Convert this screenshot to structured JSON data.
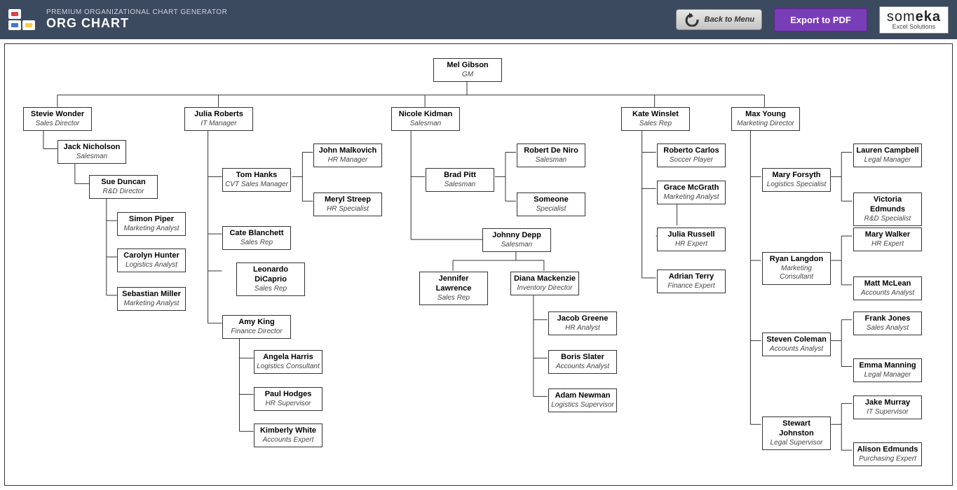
{
  "header": {
    "subtitle": "PREMIUM ORGANIZATIONAL CHART GENERATOR",
    "title": "ORG CHART",
    "back_label": "Back to Menu",
    "export_label": "Export to PDF",
    "brand_name_light": "som",
    "brand_name_bold": "eka",
    "brand_tag": "Excel Solutions"
  },
  "nodes": {
    "root": {
      "name": "Mel Gibson",
      "role": "GM"
    },
    "stevie": {
      "name": "Stevie Wonder",
      "role": "Sales Director"
    },
    "julia": {
      "name": "Julia Roberts",
      "role": "IT Manager"
    },
    "nicole": {
      "name": "Nicole Kidman",
      "role": "Salesman"
    },
    "kate": {
      "name": "Kate Winslet",
      "role": "Sales Rep"
    },
    "max": {
      "name": "Max Young",
      "role": "Marketing Director"
    },
    "jack": {
      "name": "Jack Nicholson",
      "role": "Salesman"
    },
    "sue": {
      "name": "Sue Duncan",
      "role": "R&D Director"
    },
    "simon": {
      "name": "Simon Piper",
      "role": "Marketing Analyst"
    },
    "carolyn": {
      "name": "Carolyn Hunter",
      "role": "Logistics Analyst"
    },
    "sebastian": {
      "name": "Sebastian Miller",
      "role": "Marketing Analyst"
    },
    "tom": {
      "name": "Tom Hanks",
      "role": "CVT Sales Manager"
    },
    "john": {
      "name": "John Malkovich",
      "role": "HR Manager"
    },
    "meryl": {
      "name": "Meryl Streep",
      "role": "HR Specialist"
    },
    "cate": {
      "name": "Cate Blanchett",
      "role": "Sales Rep"
    },
    "leo": {
      "name": "Leonardo DiCaprio",
      "role": "Sales Rep"
    },
    "amy": {
      "name": "Amy King",
      "role": "Finance Director"
    },
    "angela": {
      "name": "Angela Harris",
      "role": "Logistics Consultant"
    },
    "paul": {
      "name": "Paul Hodges",
      "role": "HR Supervisor"
    },
    "kimberly": {
      "name": "Kimberly White",
      "role": "Accounts Expert"
    },
    "brad": {
      "name": "Brad Pitt",
      "role": "Salesman"
    },
    "robert": {
      "name": "Robert De Niro",
      "role": "Salesman"
    },
    "someone": {
      "name": "Someone",
      "role": "Specialist"
    },
    "johnny": {
      "name": "Johnny Depp",
      "role": "Salesman"
    },
    "jennifer": {
      "name": "Jennifer Lawrence",
      "role": "Sales Rep"
    },
    "diana": {
      "name": "Diana Mackenzie",
      "role": "Inventory Director"
    },
    "jacob": {
      "name": "Jacob Greene",
      "role": "HR Analyst"
    },
    "boris": {
      "name": "Boris Slater",
      "role": "Accounts Analyst"
    },
    "adam": {
      "name": "Adam Newman",
      "role": "Logistics Supervisor"
    },
    "roberto": {
      "name": "Roberto Carlos",
      "role": "Soccer Player"
    },
    "grace": {
      "name": "Grace McGrath",
      "role": "Marketing Analyst"
    },
    "juliar": {
      "name": "Julia Russell",
      "role": "HR Expert"
    },
    "adrian": {
      "name": "Adrian Terry",
      "role": "Finance Expert"
    },
    "mary": {
      "name": "Mary Forsyth",
      "role": "Logistics Specialist"
    },
    "lauren": {
      "name": "Lauren Campbell",
      "role": "Legal Manager"
    },
    "victoria": {
      "name": "Victoria Edmunds",
      "role": "R&D Specialist"
    },
    "ryan": {
      "name": "Ryan Langdon",
      "role": "Marketing Consultant"
    },
    "marywalker": {
      "name": "Mary Walker",
      "role": "HR Expert"
    },
    "matt": {
      "name": "Matt McLean",
      "role": "Accounts Analyst"
    },
    "steven": {
      "name": "Steven Coleman",
      "role": "Accounts Analyst"
    },
    "frank": {
      "name": "Frank Jones",
      "role": "Sales Analyst"
    },
    "emma": {
      "name": "Emma Manning",
      "role": "Legal Manager"
    },
    "stewart": {
      "name": "Stewart Johnston",
      "role": "Legal Supervisor"
    },
    "jake": {
      "name": "Jake Murray",
      "role": "IT Supervisor"
    },
    "alison": {
      "name": "Alison Edmunds",
      "role": "Purchasing Expert"
    }
  }
}
